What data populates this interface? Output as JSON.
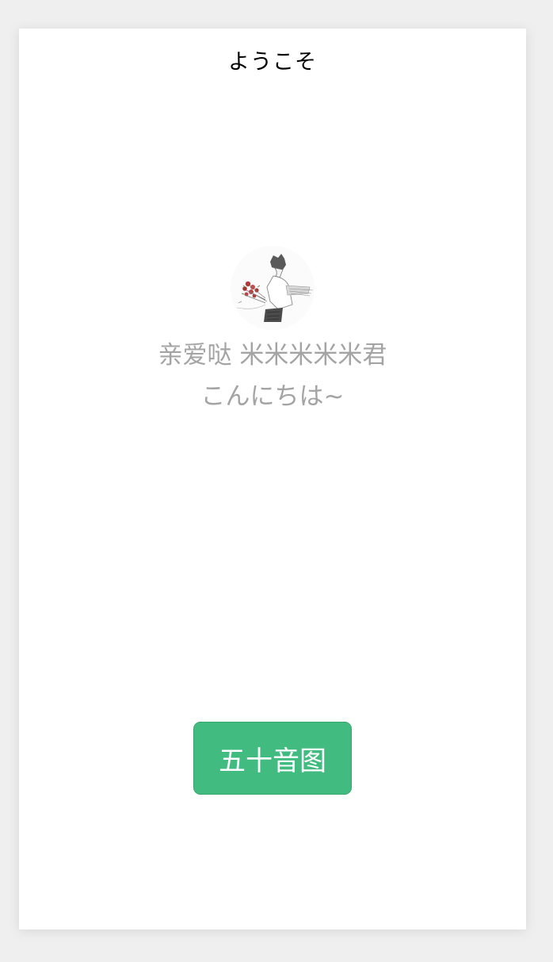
{
  "nav": {
    "title": "ようこそ"
  },
  "profile": {
    "avatar_icon": "user-avatar-illustration",
    "greeting_name": "亲爱哒 米米米米米君",
    "greeting_hello": "こんにちは~"
  },
  "actions": {
    "primary_button_label": "五十音图",
    "primary_button_color": "#42bb80"
  }
}
